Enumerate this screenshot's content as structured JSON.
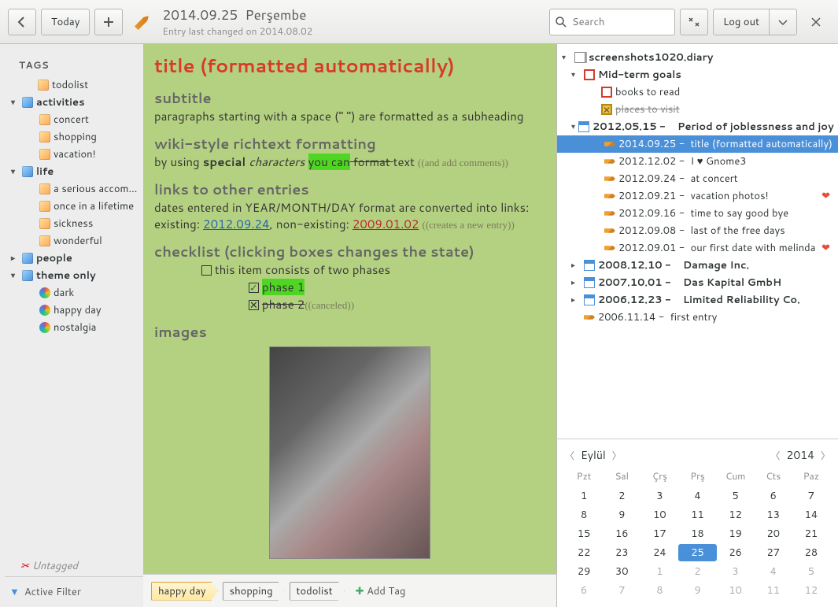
{
  "toolbar": {
    "today": "Today",
    "title_date": "2014.09.25",
    "title_day": "Perşembe",
    "subtitle": "Entry last changed on 2014.08.02",
    "search_placeholder": "Search",
    "logout": "Log out"
  },
  "tags": {
    "heading": "TAGS",
    "groups": [
      {
        "name": "todolist",
        "color": "yellow",
        "items": []
      },
      {
        "name": "activities",
        "color": "blue",
        "items": [
          "concert",
          "shopping",
          "vacation!"
        ]
      },
      {
        "name": "life",
        "color": "blue",
        "items": [
          "a serious accom...",
          "once in a lifetime",
          "sickness",
          "wonderful"
        ]
      },
      {
        "name": "people",
        "color": "blue",
        "items": []
      },
      {
        "name": "theme only",
        "color": "blue",
        "items": [
          "dark",
          "happy day",
          "nostalgia"
        ]
      }
    ],
    "untagged": "Untagged",
    "active_filter": "Active Filter"
  },
  "editor": {
    "title": "title (formatted automatically)",
    "subtitle_h": "subtitle",
    "subtitle_p": "paragraphs starting with a space (\" \") are formatted as a subheading",
    "wiki_h": "wiki-style richtext formatting",
    "wiki_pre": "by using ",
    "wiki_bold": "special",
    "wiki_ital": " characters ",
    "wiki_hl": "you can",
    "wiki_strike": " format ",
    "wiki_post": " text ",
    "wiki_comment": "((and add comments))",
    "links_h": "links to other entries",
    "links_p1": "dates entered in YEAR/MONTH/DAY format are converted into links:",
    "links_exist_label": "existing: ",
    "links_exist": "2012.09.24",
    "links_nonexist_label": ", non-existing: ",
    "links_nonexist": "2009.01.02",
    "links_comment": "((creates a new entry))",
    "check_h": "checklist (clicking boxes changes the state)",
    "check_item1": "this item consists of two phases",
    "check_item2": "phase 1",
    "check_item3": "phase 2",
    "check_comment": "((canceled))",
    "images_h": "images"
  },
  "tagbar": {
    "chips": [
      "happy day",
      "shopping",
      "todolist"
    ],
    "add": "Add Tag"
  },
  "tree": {
    "root": "screenshots1020.diary",
    "midterm": "Mid-term goals",
    "books": "books to read",
    "places": "places to visit",
    "period_date": "2012.05.15 -",
    "period_label": "Period of joblessness and joy",
    "entries": [
      {
        "date": "2014.09.25 -",
        "title": "title (formatted automatically)",
        "sel": true
      },
      {
        "date": "2012.12.02 -",
        "title": "I ♥ Gnome3"
      },
      {
        "date": "2012.09.24 -",
        "title": "at concert"
      },
      {
        "date": "2012.09.21 -",
        "title": "vacation photos!",
        "heart": true
      },
      {
        "date": "2012.09.16 -",
        "title": "time to say good bye"
      },
      {
        "date": "2012.09.08 -",
        "title": "last of the free days"
      },
      {
        "date": "2012.09.01 -",
        "title": "our first date with melinda",
        "heart": true
      }
    ],
    "collapsed": [
      {
        "date": "2008.12.10 -",
        "title": "Damage Inc."
      },
      {
        "date": "2007.10.01 -",
        "title": "Das Kapital GmbH"
      },
      {
        "date": "2006.12.23 -",
        "title": "Limited Reliability Co."
      }
    ],
    "first": {
      "date": "2006.11.14 -",
      "title": "first entry"
    }
  },
  "calendar": {
    "month": "Eylül",
    "year": "2014",
    "dow": [
      "Pzt",
      "Sal",
      "Çrş",
      "Prş",
      "Cum",
      "Cts",
      "Paz"
    ],
    "weeks": [
      [
        1,
        2,
        3,
        4,
        5,
        6,
        7
      ],
      [
        8,
        9,
        10,
        11,
        12,
        13,
        14
      ],
      [
        15,
        16,
        17,
        18,
        19,
        20,
        21
      ],
      [
        22,
        23,
        24,
        25,
        26,
        27,
        28
      ],
      [
        29,
        30,
        1,
        2,
        3,
        4,
        5
      ],
      [
        6,
        7,
        8,
        9,
        10,
        11,
        12
      ]
    ],
    "selected": 25,
    "other_start_row": 4,
    "other_start_col": 2
  }
}
